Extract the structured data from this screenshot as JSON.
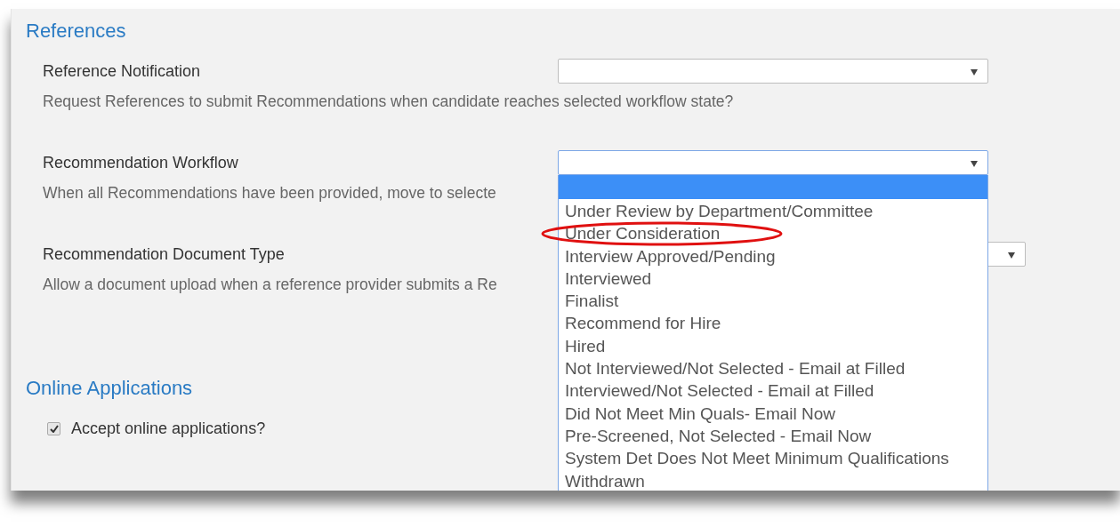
{
  "sections": [
    {
      "heading": "References",
      "fields": [
        {
          "kind": "select",
          "label": "Reference Notification",
          "description": "Request References to submit Recommendations when candidate reaches selected workflow state?",
          "open": false
        },
        {
          "kind": "select",
          "label": "Recommendation Workflow",
          "description": "When all Recommendations have been provided, move to selecte",
          "open": true,
          "options": [
            {
              "selected": true,
              "circled": false
            },
            {
              "label": "Under Review by Department/Committee",
              "selected": false,
              "circled": false
            },
            {
              "label": "Under Consideration",
              "selected": false,
              "circled": true
            },
            {
              "label": "Interview Approved/Pending",
              "selected": false,
              "circled": false
            },
            {
              "label": "Interviewed",
              "selected": false,
              "circled": false
            },
            {
              "label": "Finalist",
              "selected": false,
              "circled": false
            },
            {
              "label": "Recommend for Hire",
              "selected": false,
              "circled": false
            },
            {
              "label": "Hired",
              "selected": false,
              "circled": false
            },
            {
              "label": "Not Interviewed/Not Selected - Email at Filled",
              "selected": false,
              "circled": false
            },
            {
              "label": "Interviewed/Not Selected - Email at Filled",
              "selected": false,
              "circled": false
            },
            {
              "label": "Did Not Meet Min Quals- Email Now",
              "selected": false,
              "circled": false
            },
            {
              "label": "Pre-Screened, Not Selected - Email Now",
              "selected": false,
              "circled": false
            },
            {
              "label": "System Det Does Not Meet Minimum Qualifications",
              "selected": false,
              "circled": false
            },
            {
              "label": "Withdrawn",
              "selected": false,
              "circled": false
            }
          ]
        },
        {
          "kind": "select",
          "label": "Recommendation Document Type",
          "description": "Allow a document upload when a reference provider submits a Re",
          "open": false
        }
      ]
    },
    {
      "heading": "Online Applications",
      "fields": [
        {
          "kind": "checkbox",
          "label": "Accept online applications?",
          "checked": true
        }
      ]
    }
  ]
}
